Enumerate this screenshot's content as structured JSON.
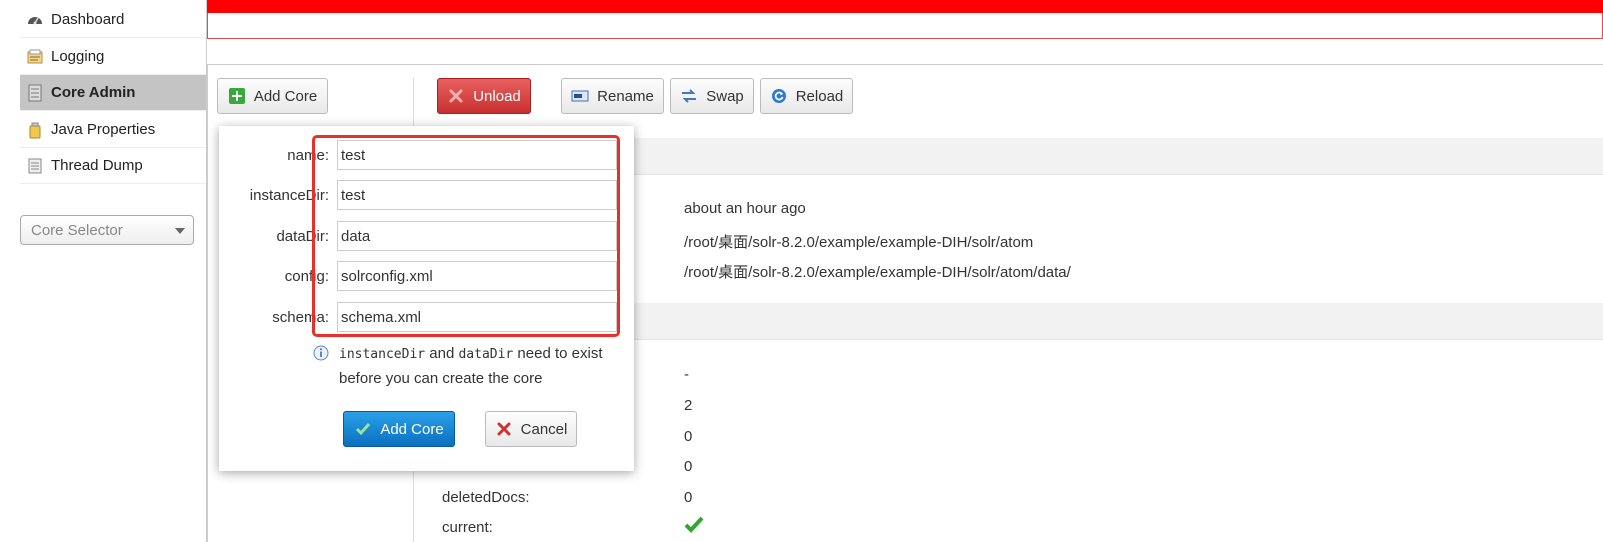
{
  "sidebar": {
    "items": [
      {
        "label": "Dashboard",
        "icon": "dashboard-icon"
      },
      {
        "label": "Logging",
        "icon": "logging-icon"
      },
      {
        "label": "Core Admin",
        "icon": "core-admin-icon",
        "active": true
      },
      {
        "label": "Java Properties",
        "icon": "java-properties-icon"
      },
      {
        "label": "Thread Dump",
        "icon": "thread-dump-icon"
      }
    ],
    "core_selector_placeholder": "Core Selector"
  },
  "toolbar": {
    "add_core": "Add Core",
    "unload": "Unload",
    "rename": "Rename",
    "swap": "Swap",
    "reload": "Reload"
  },
  "core_info": {
    "start_time": "about an hour ago",
    "instance_dir": "/root/桌面/solr-8.2.0/example/example-DIH/solr/atom",
    "data_dir": "/root/桌面/solr-8.2.0/example/example-DIH/solr/atom/data/"
  },
  "index_info": {
    "last_modified": "-",
    "version": "2",
    "num_docs": "0",
    "max_doc": "0",
    "deleted_docs_label": "deletedDocs:",
    "deleted_docs": "0",
    "current_label": "current:"
  },
  "dialog": {
    "fields": [
      {
        "label": "name:",
        "value": "test"
      },
      {
        "label": "instanceDir:",
        "value": "test"
      },
      {
        "label": "dataDir:",
        "value": "data"
      },
      {
        "label": "config:",
        "value": "solrconfig.xml"
      },
      {
        "label": "schema:",
        "value": "schema.xml"
      }
    ],
    "note_code1": "instanceDir",
    "note_and": " and ",
    "note_code2": "dataDir",
    "note_rest": " need to exist",
    "note_line2": "before you can create the core",
    "add_button": "Add Core",
    "cancel_button": "Cancel"
  },
  "colors": {
    "header_red": "#ff0000",
    "highlight": "#e8302b",
    "unload_red": "#c93030",
    "primary_blue": "#0a70c0",
    "check_green": "#2ea82e"
  }
}
